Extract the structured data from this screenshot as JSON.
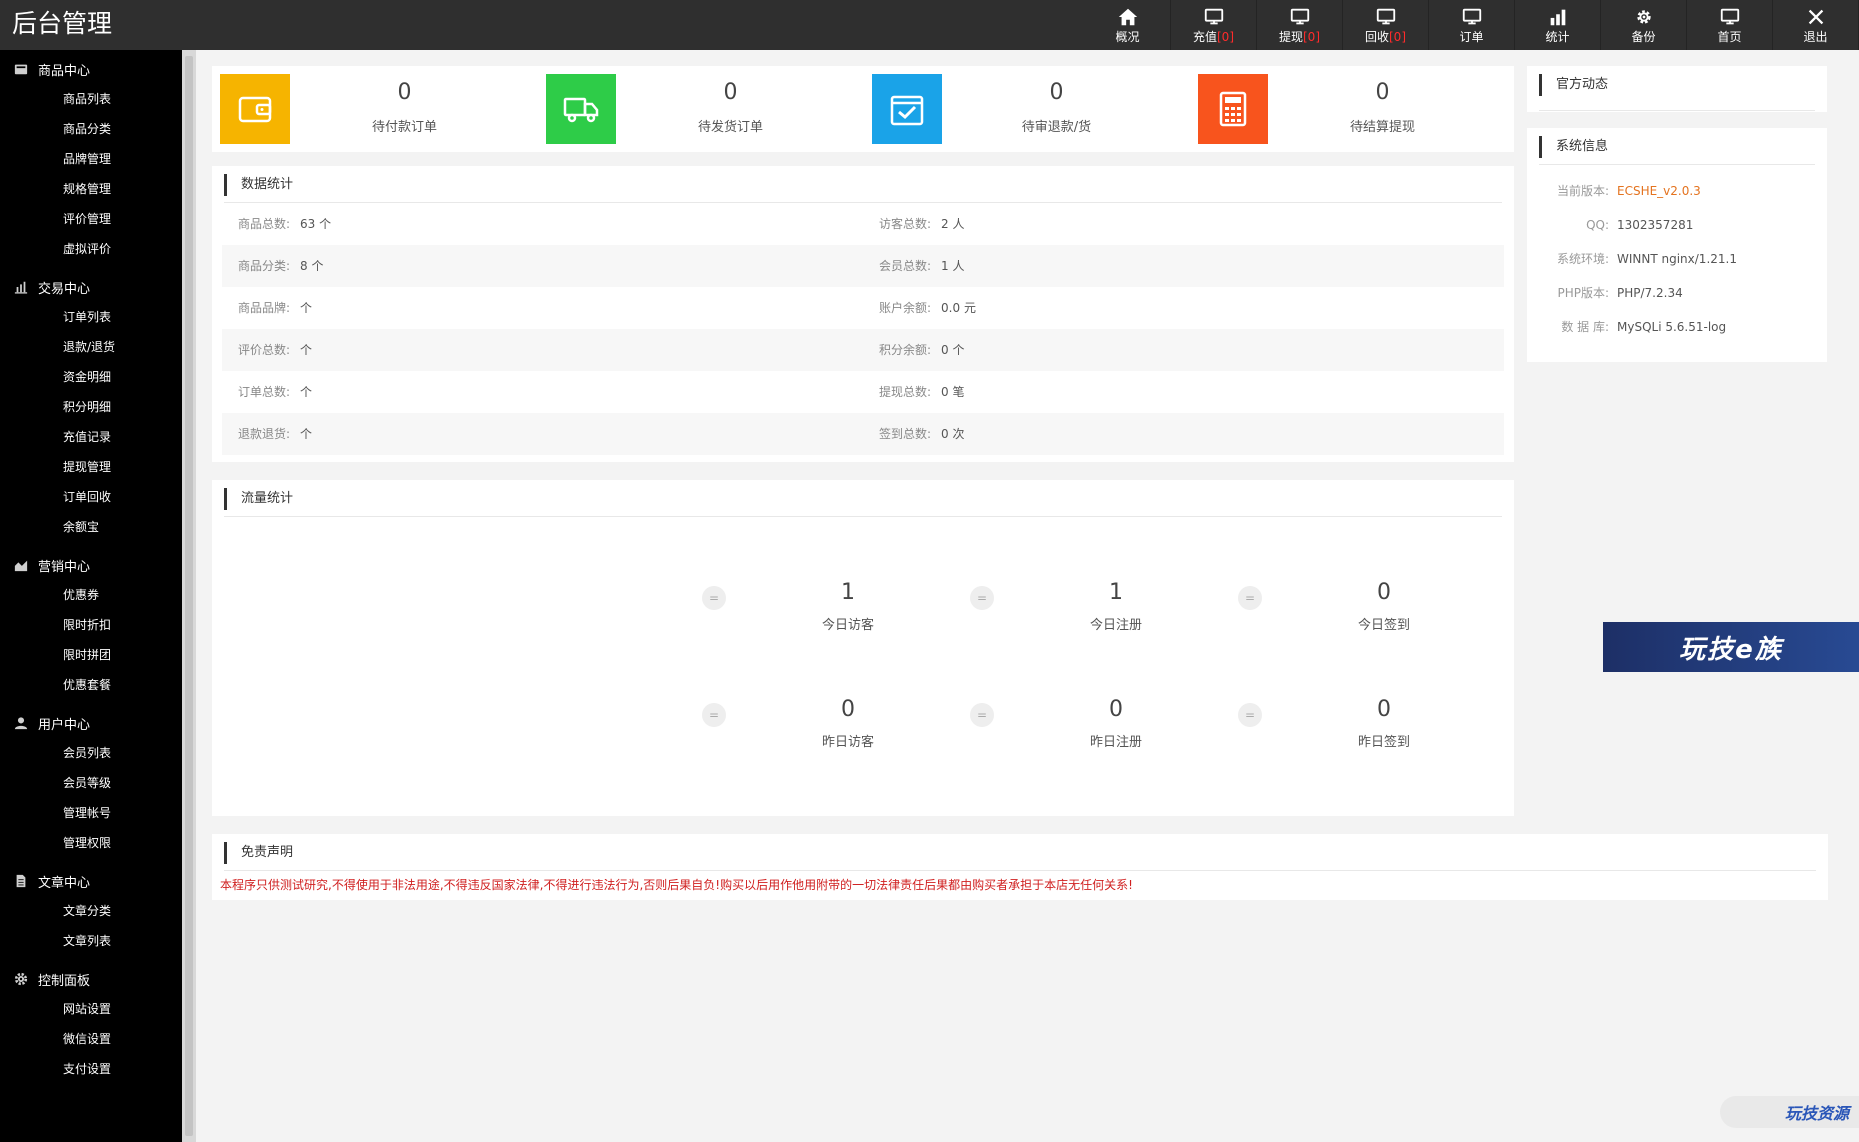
{
  "app": {
    "title": "后台管理"
  },
  "topnav": [
    {
      "label": "概况",
      "badge": "",
      "icon": "home-icon"
    },
    {
      "label": "充值",
      "badge": "[0]",
      "icon": "monitor-icon"
    },
    {
      "label": "提现",
      "badge": "[0]",
      "icon": "monitor-icon"
    },
    {
      "label": "回收",
      "badge": "[0]",
      "icon": "monitor-icon"
    },
    {
      "label": "订单",
      "badge": "",
      "icon": "monitor-icon"
    },
    {
      "label": "统计",
      "badge": "",
      "icon": "bar-chart-icon"
    },
    {
      "label": "备份",
      "badge": "",
      "icon": "gear-icon"
    },
    {
      "label": "首页",
      "badge": "",
      "icon": "monitor-icon"
    },
    {
      "label": "退出",
      "badge": "",
      "icon": "close-icon"
    }
  ],
  "sidebar": {
    "sections": [
      {
        "title": "商品中心",
        "icon": "box-icon",
        "items": [
          "商品列表",
          "商品分类",
          "品牌管理",
          "规格管理",
          "评价管理",
          "虚拟评价"
        ]
      },
      {
        "title": "交易中心",
        "icon": "bar-chart-icon",
        "items": [
          "订单列表",
          "退款/退货",
          "资金明细",
          "积分明细",
          "充值记录",
          "提现管理",
          "订单回收",
          "余额宝"
        ]
      },
      {
        "title": "营销中心",
        "icon": "area-chart-icon",
        "items": [
          "优惠券",
          "限时折扣",
          "限时拼团",
          "优惠套餐"
        ]
      },
      {
        "title": "用户中心",
        "icon": "user-icon",
        "items": [
          "会员列表",
          "会员等级",
          "管理帐号",
          "管理权限"
        ]
      },
      {
        "title": "文章中心",
        "icon": "document-icon",
        "items": [
          "文章分类",
          "文章列表"
        ]
      },
      {
        "title": "控制面板",
        "icon": "gear-icon",
        "items": [
          "网站设置",
          "微信设置",
          "支付设置"
        ]
      }
    ]
  },
  "stats": [
    {
      "value": "0",
      "label": "待付款订单",
      "color": "#f6b400",
      "icon": "wallet-icon"
    },
    {
      "value": "0",
      "label": "待发货订单",
      "color": "#2ecc48",
      "icon": "truck-icon"
    },
    {
      "value": "0",
      "label": "待审退款/货",
      "color": "#1aa3e8",
      "icon": "checkbox-icon"
    },
    {
      "value": "0",
      "label": "待结算提现",
      "color": "#f8541d",
      "icon": "calculator-icon"
    }
  ],
  "data_stats": {
    "title": "数据统计",
    "rows": [
      {
        "left_k": "商品总数:",
        "left_v": "63 个",
        "right_k": "访客总数:",
        "right_v": "2 人"
      },
      {
        "left_k": "商品分类:",
        "left_v": "8 个",
        "right_k": "会员总数:",
        "right_v": "1 人"
      },
      {
        "left_k": "商品品牌:",
        "left_v": "个",
        "right_k": "账户余额:",
        "right_v": "0.0 元"
      },
      {
        "left_k": "评价总数:",
        "left_v": "个",
        "right_k": "积分余额:",
        "right_v": "0 个"
      },
      {
        "left_k": "订单总数:",
        "left_v": "个",
        "right_k": "提现总数:",
        "right_v": "0 笔"
      },
      {
        "left_k": "退款退货:",
        "left_v": "个",
        "right_k": "签到总数:",
        "right_v": "0 次"
      }
    ]
  },
  "traffic": {
    "title": "流量统计",
    "dot": "=",
    "today": [
      {
        "value": "1",
        "label": "今日访客"
      },
      {
        "value": "1",
        "label": "今日注册"
      },
      {
        "value": "0",
        "label": "今日签到"
      }
    ],
    "yesterday": [
      {
        "value": "0",
        "label": "昨日访客"
      },
      {
        "value": "0",
        "label": "昨日注册"
      },
      {
        "value": "0",
        "label": "昨日签到"
      }
    ]
  },
  "disclaimer": {
    "title": "免责声明",
    "text": "本程序只供测试研究,不得使用于非法用途,不得违反国家法律,不得进行违法行为,否则后果自负!购买以后用作他用附带的一切法律责任后果都由购买者承担于本店无任何关系!"
  },
  "right": {
    "news_title": "官方动态",
    "sys_title": "系统信息",
    "sys_rows": [
      {
        "k": "当前版本:",
        "v": "ECSHE_v2.0.3"
      },
      {
        "k": "QQ:",
        "v": "1302357281"
      },
      {
        "k": "系统环境:",
        "v": "WINNT nginx/1.21.1"
      },
      {
        "k": "PHP版本:",
        "v": "PHP/7.2.34"
      },
      {
        "k": "数 据 库:",
        "v": "MySQLi 5.6.51-log"
      }
    ]
  },
  "promo": {
    "text": "玩技e族"
  },
  "watermark": {
    "text": "玩技资源"
  }
}
